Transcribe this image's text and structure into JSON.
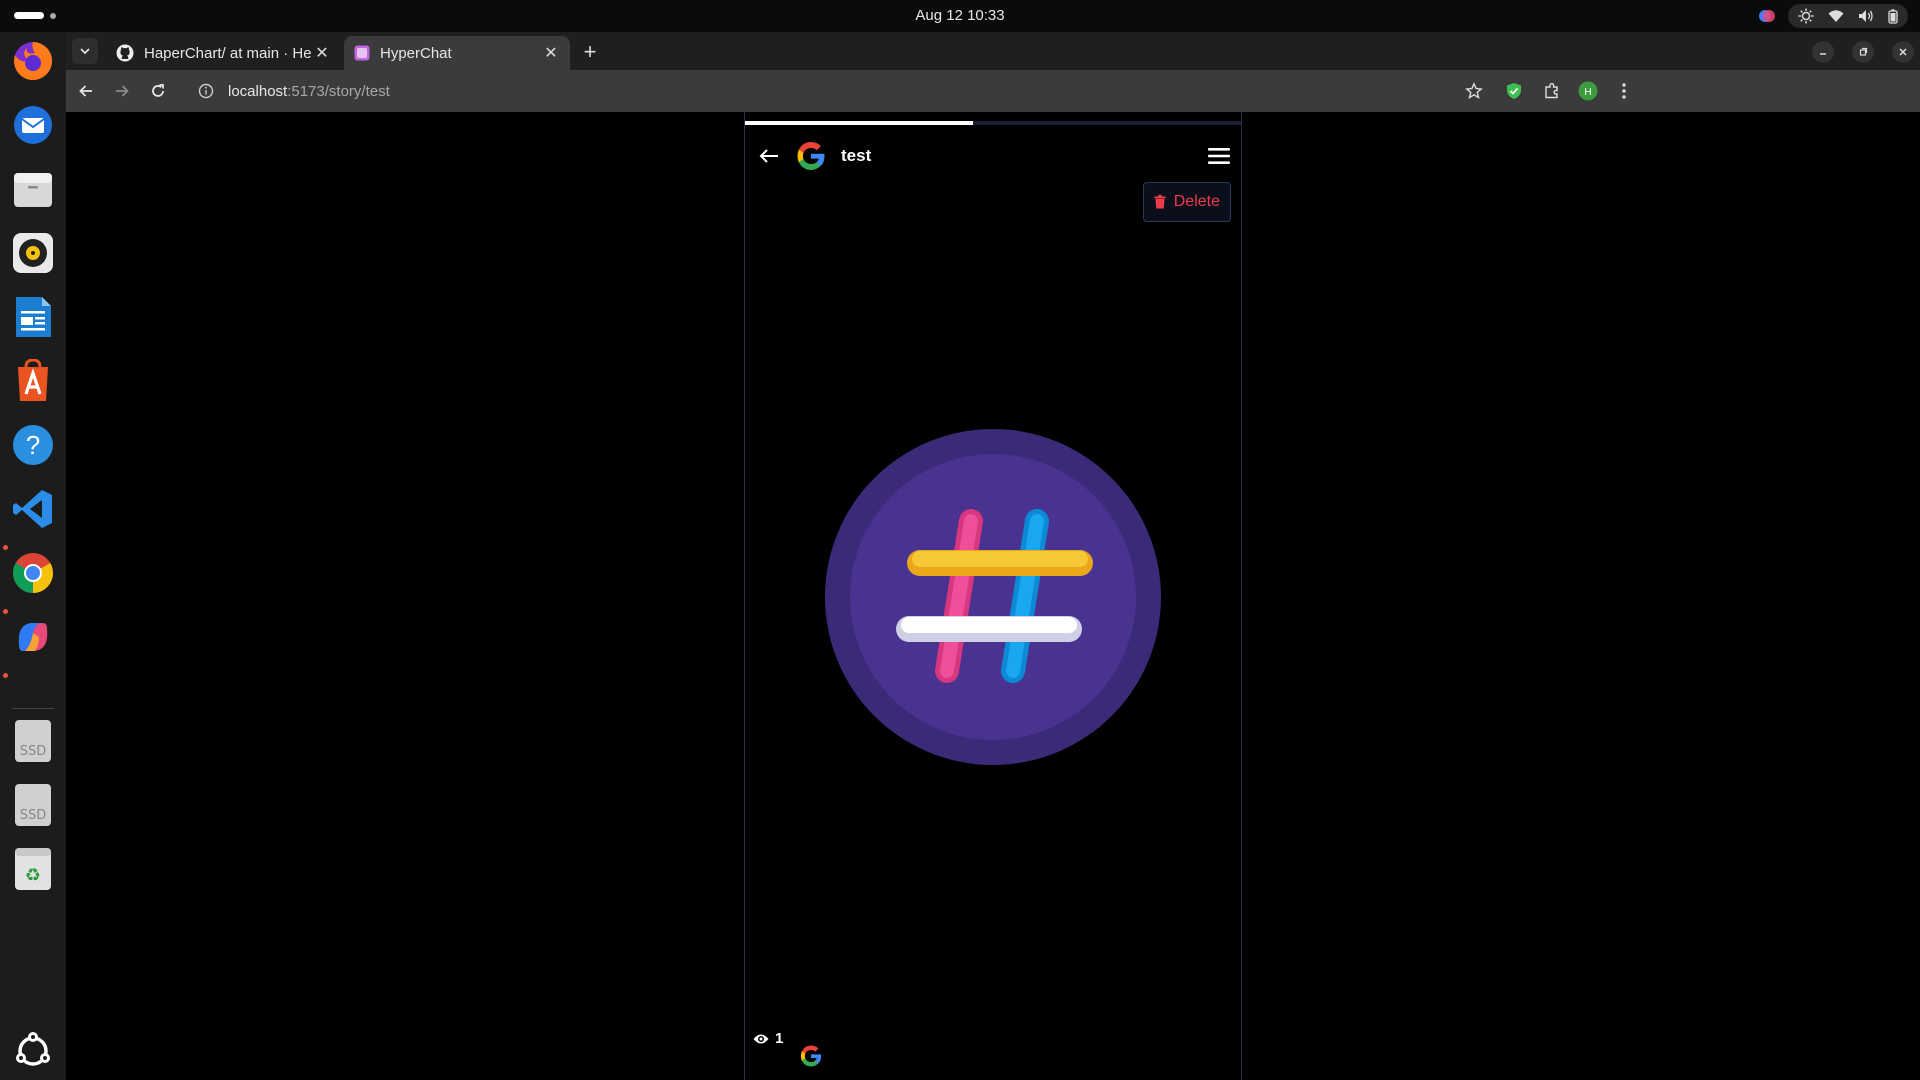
{
  "system": {
    "datetime": "Aug 12  10:33"
  },
  "dock": {
    "items": [
      "firefox-icon",
      "thunderbird-icon",
      "files-icon",
      "rhythmbox-icon",
      "writer-icon",
      "app-center-icon",
      "help-icon",
      "vscode-icon",
      "chrome-icon",
      "copilot-icon",
      "ssd-drive-icon",
      "ssd-drive-icon",
      "trash-icon",
      "show-apps-icon"
    ],
    "ssd_label": "SSD"
  },
  "browser": {
    "tabs": [
      {
        "title": "HaperChart/ at main · He",
        "active": false
      },
      {
        "title": "HyperChat",
        "active": true
      }
    ],
    "url_host": "localhost",
    "url_rest": ":5173/story/test",
    "profile_initial": "H"
  },
  "story": {
    "progress_fraction": 0.46,
    "title": "test",
    "delete_label": "Delete",
    "view_count": "1"
  },
  "colors": {
    "accent_delete": "#ef3b4a",
    "image_bg_outer": "#3a2a78",
    "image_bg_inner": "#4a3290"
  }
}
